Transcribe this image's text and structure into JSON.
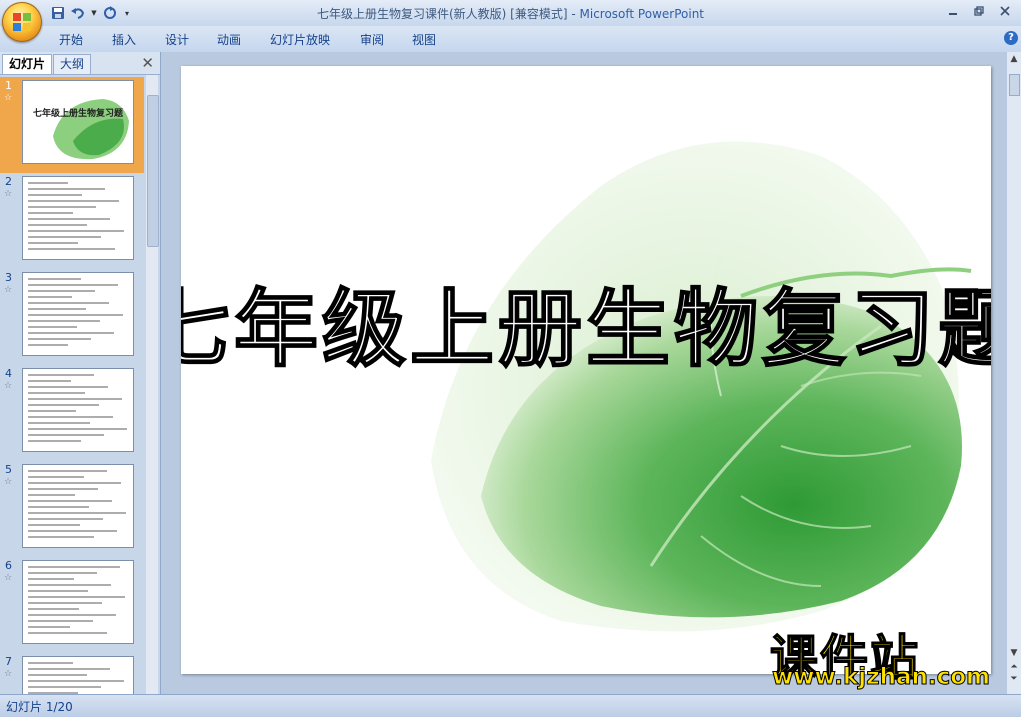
{
  "window": {
    "title": "七年级上册生物复习课件(新人教版) [兼容模式]",
    "title_sep": " - ",
    "app_name": "Microsoft PowerPoint"
  },
  "ribbon_tabs": [
    "开始",
    "插入",
    "设计",
    "动画",
    "幻灯片放映",
    "审阅",
    "视图"
  ],
  "pane": {
    "tab_slides": "幻灯片",
    "tab_outline": "大纲",
    "close_icon": "close-icon",
    "thumbnails": [
      {
        "number": "1",
        "star": "☆"
      },
      {
        "number": "2",
        "star": "☆"
      },
      {
        "number": "3",
        "star": "☆"
      },
      {
        "number": "4",
        "star": "☆"
      },
      {
        "number": "5",
        "star": "☆"
      },
      {
        "number": "6",
        "star": "☆"
      },
      {
        "number": "7",
        "star": "☆"
      }
    ],
    "selected_slide": 1
  },
  "slide": {
    "title": "七年级上册生物复习题"
  },
  "status": {
    "slide_counter": "幻灯片 1/20"
  },
  "watermark": {
    "brand": "课件站",
    "url": "www.kjzhan.com"
  },
  "colors": {
    "leaf_dark": "#2e9a35",
    "leaf_light": "#bfe3b3",
    "selection": "#f0a64a",
    "watermark": "#ffe100"
  }
}
